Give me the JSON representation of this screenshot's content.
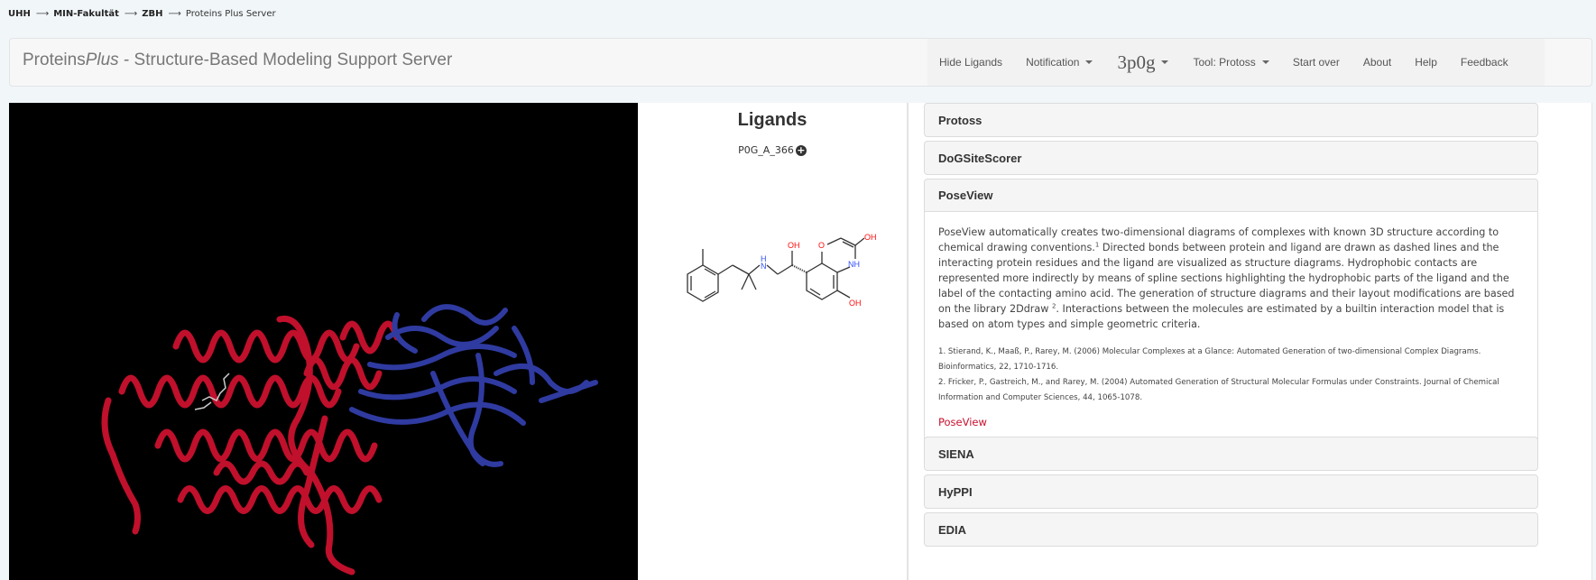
{
  "breadcrumb": [
    {
      "label": "UHH"
    },
    {
      "label": "MIN-Fakultät"
    },
    {
      "label": "ZBH"
    },
    {
      "label": "Proteins Plus Server"
    }
  ],
  "breadcrumb_separator": "⟶",
  "header": {
    "brand_prefix": "Proteins",
    "brand_italic": "Plus",
    "brand_suffix": " - Structure-Based Modeling Support Server",
    "nav": {
      "hide_ligands": "Hide Ligands",
      "notification": "Notification",
      "pdb_code": "3p0g",
      "tool": "Tool: Protoss",
      "start_over": "Start over",
      "about": "About",
      "help": "Help",
      "feedback": "Feedback"
    }
  },
  "viewer": {
    "background": "#000000",
    "chain_colors": {
      "chain_a": "#c0102c",
      "chain_b": "#2f3ba0"
    }
  },
  "ligands": {
    "title": "Ligands",
    "ligand_id": "P0G_A_366",
    "add_icon": "plus-circle-icon",
    "atom_labels": {
      "oh_top": "OH",
      "o_ring": "O",
      "oh_right": "OH",
      "nh_ring": "NH",
      "nh_chain": "N",
      "h_chain": "H",
      "oh_bottom": "OH"
    },
    "colors": {
      "oxygen": "#ff0d0d",
      "nitrogen": "#3050f8",
      "bond": "#333333"
    }
  },
  "accordion": {
    "panels": [
      {
        "title": "Protoss"
      },
      {
        "title": "DoGSiteScorer"
      },
      {
        "title": "PoseView"
      },
      {
        "title": "SIENA"
      },
      {
        "title": "HyPPI"
      },
      {
        "title": "EDIA"
      }
    ],
    "poseview": {
      "text_a": "PoseView automatically creates two-dimensional diagrams of complexes with known 3D structure according to chemical drawing conventions.",
      "sup_1": "1",
      "text_b": " Directed bonds between protein and ligand are drawn as dashed lines and the interacting protein residues and the ligand are visualized as structure diagrams. Hydrophobic contacts are represented more indirectly by means of spline sections highlighting the hydrophobic parts of the ligand and the label of the contacting amino acid. The generation of structure diagrams and their layout modifications are based on the library 2Ddraw ",
      "sup_2": "2",
      "text_c": ". Interactions between the molecules are estimated by a builtin interaction model that is based on atom types and simple geometric criteria.",
      "references": [
        "1. Stierand, K., Maaß, P., Rarey, M. (2006) Molecular Complexes at a Glance: Automated Generation of two-dimensional Complex Diagrams. Bioinformatics, 22, 1710-1716.",
        "2. Fricker, P., Gastreich, M., and Rarey, M. (2004) Automated Generation of Structural Molecular Formulas under Constraints. Journal of Chemical Information and Computer Sciences, 44, 1065-1078."
      ],
      "link_label": "PoseView",
      "link_color": "#c8102e"
    }
  }
}
